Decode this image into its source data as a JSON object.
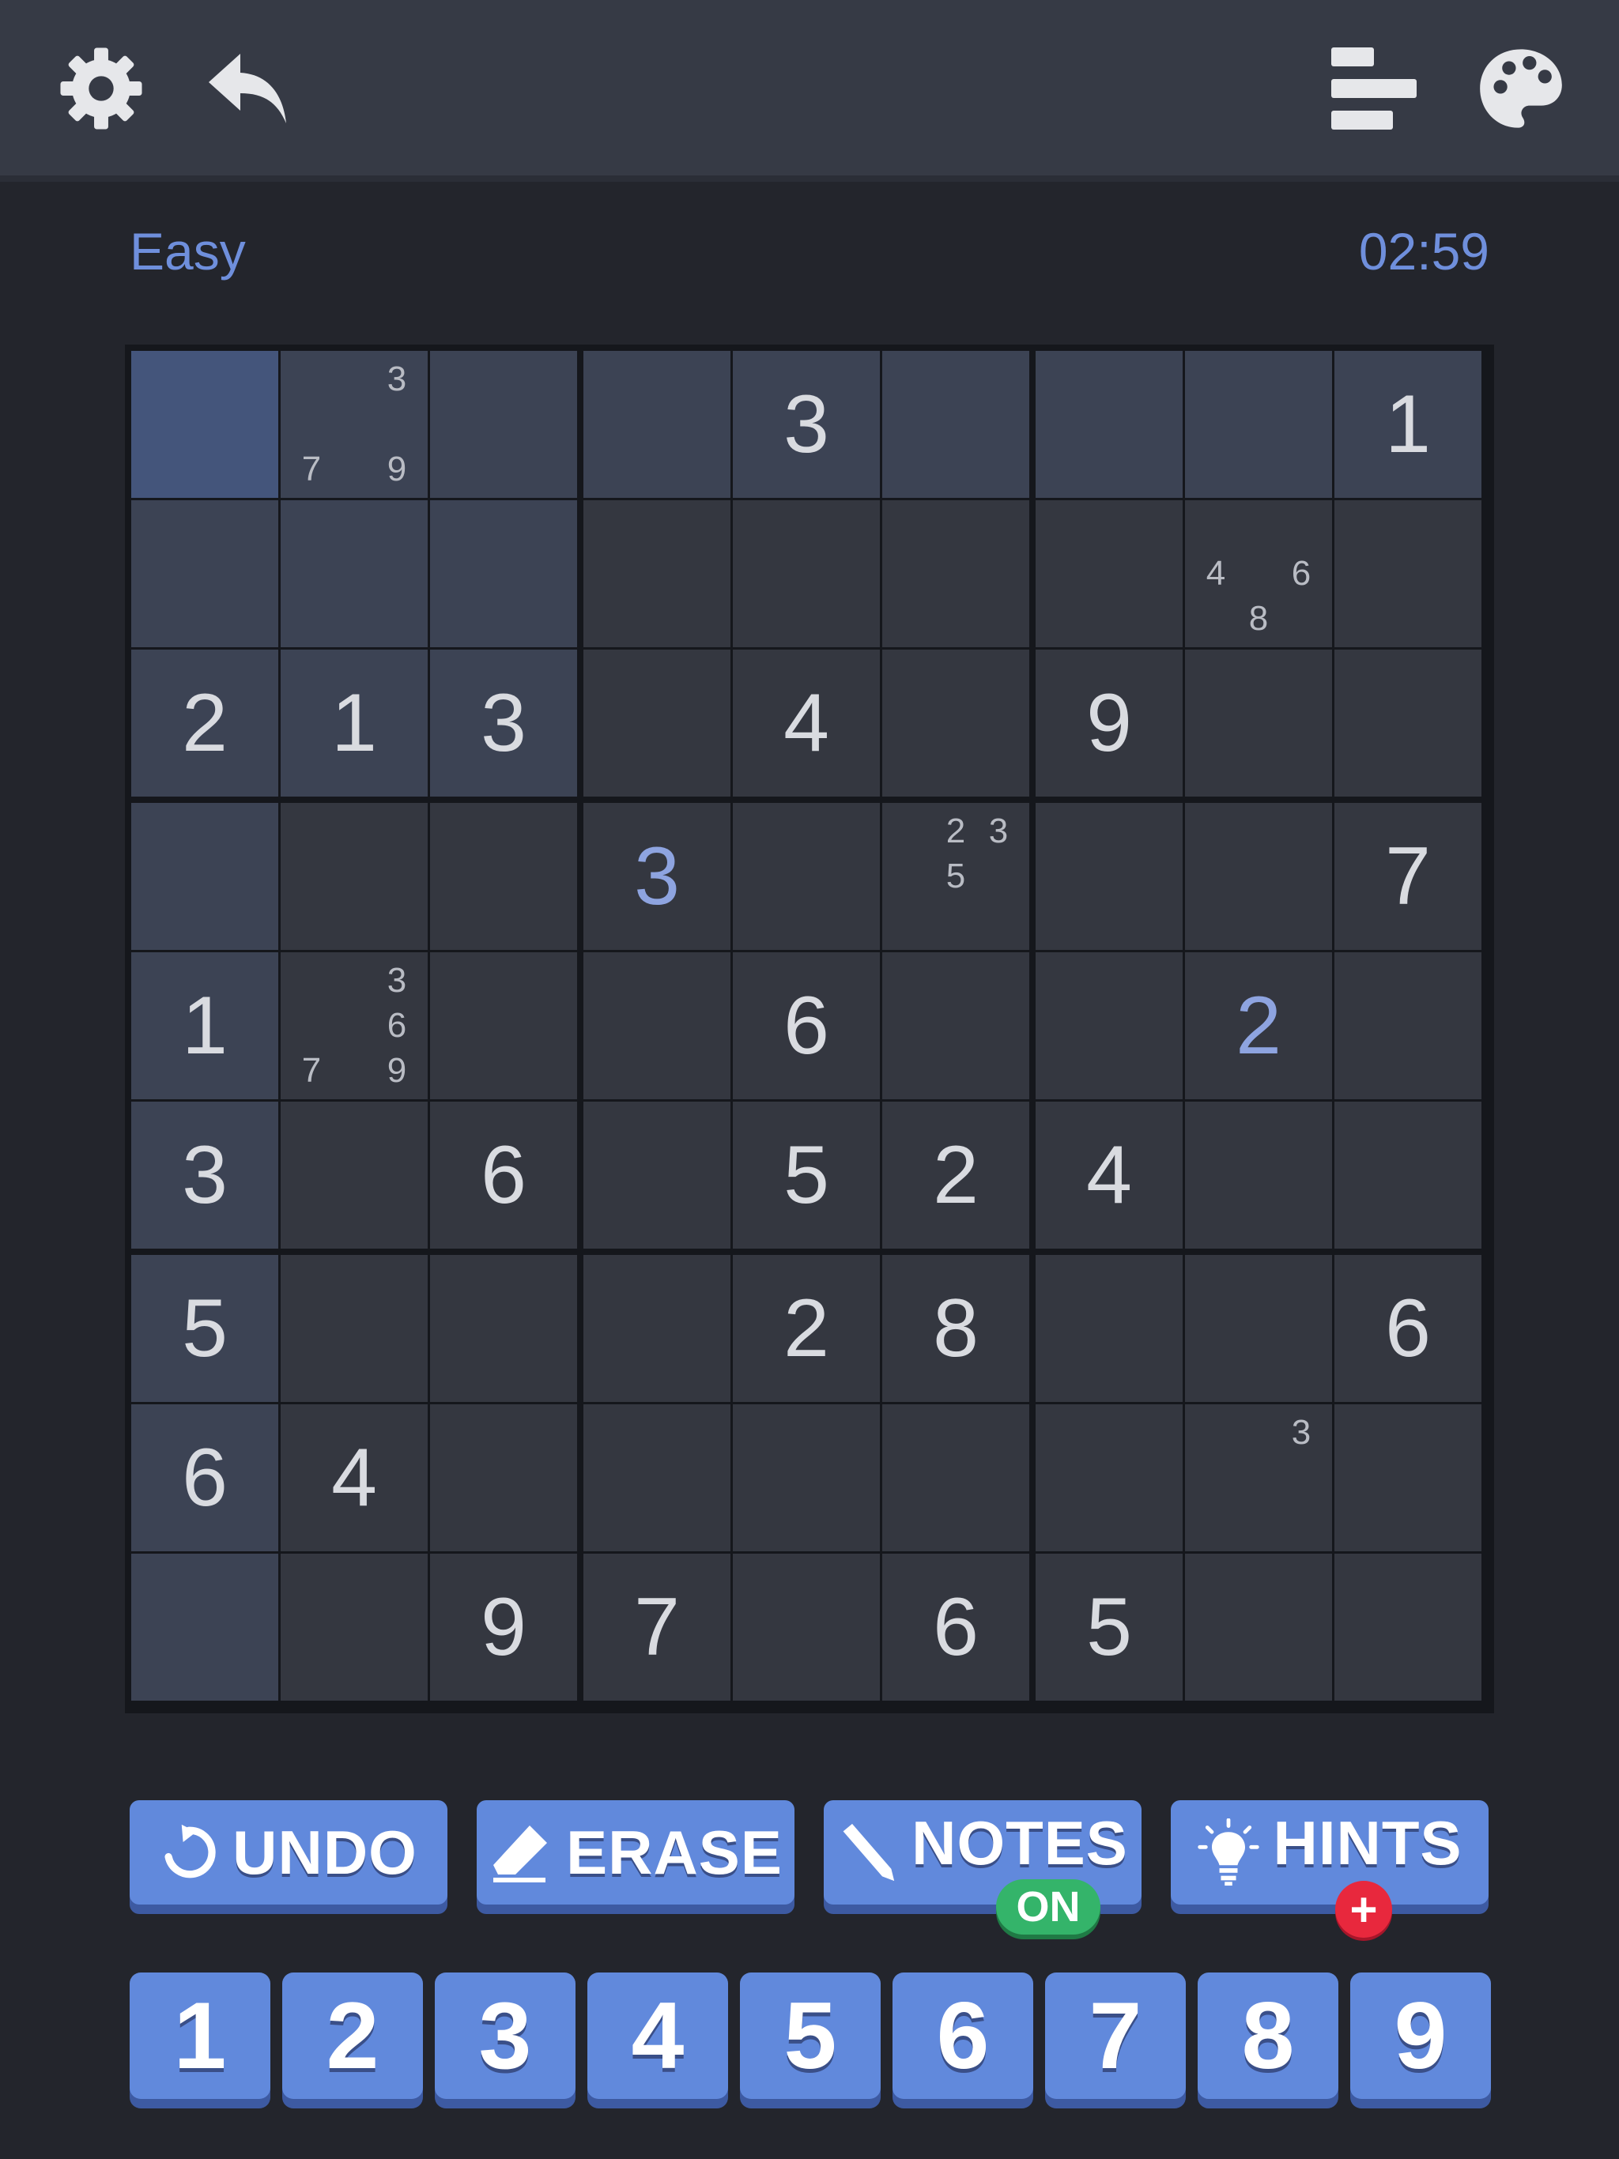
{
  "header": {
    "icons": [
      "gear-icon",
      "back-arrow-icon",
      "leaderboard-icon",
      "palette-icon"
    ]
  },
  "game": {
    "difficulty": "Easy",
    "timer": "02:59"
  },
  "board": {
    "selected": [
      0,
      0
    ],
    "cells": [
      [
        0,
        [
          3,
          7,
          9
        ],
        0,
        0,
        3,
        0,
        0,
        0,
        1
      ],
      [
        0,
        0,
        0,
        0,
        0,
        0,
        0,
        [
          4,
          6,
          8
        ],
        0
      ],
      [
        2,
        1,
        3,
        0,
        4,
        0,
        9,
        0,
        0
      ],
      [
        0,
        0,
        0,
        {
          "user": 3
        },
        0,
        [
          2,
          3,
          5
        ],
        0,
        0,
        7
      ],
      [
        1,
        [
          3,
          6,
          7,
          9
        ],
        0,
        0,
        6,
        0,
        0,
        {
          "user": 2
        },
        0
      ],
      [
        3,
        0,
        6,
        0,
        5,
        2,
        4,
        0,
        0
      ],
      [
        5,
        0,
        0,
        0,
        2,
        8,
        0,
        0,
        6
      ],
      [
        6,
        4,
        0,
        0,
        0,
        0,
        0,
        [
          3
        ],
        0
      ],
      [
        0,
        0,
        9,
        7,
        0,
        6,
        5,
        0,
        0
      ]
    ]
  },
  "actions": {
    "undo": "UNDO",
    "erase": "ERASE",
    "notes": "NOTES",
    "notes_state": "ON",
    "hints": "HINTS",
    "hints_badge": "+"
  },
  "numpad": [
    "1",
    "2",
    "3",
    "4",
    "5",
    "6",
    "7",
    "8",
    "9"
  ],
  "colors": {
    "accent": "#6189dc",
    "background": "#23252c",
    "cell": "#343740",
    "highlight": "#3c4354",
    "selected": "#44557b",
    "notes_on": "#34b46a",
    "hint_badge": "#e8283d"
  }
}
